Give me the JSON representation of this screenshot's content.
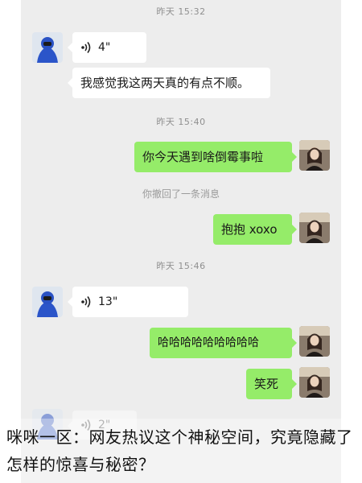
{
  "chat": {
    "messages": [
      {
        "kind": "timestamp",
        "text": "昨天 15:32"
      },
      {
        "kind": "voice",
        "side": "in",
        "duration": "4\""
      },
      {
        "kind": "text",
        "side": "in",
        "text": "我感觉我这两天真的有点不顺。"
      },
      {
        "kind": "timestamp",
        "text": "昨天 15:40"
      },
      {
        "kind": "text",
        "side": "out",
        "text": "你今天遇到啥倒霉事啦"
      },
      {
        "kind": "system",
        "text": "你撤回了一条消息"
      },
      {
        "kind": "text",
        "side": "out",
        "text": "抱抱 xoxo"
      },
      {
        "kind": "timestamp",
        "text": "昨天 15:46"
      },
      {
        "kind": "voice",
        "side": "in",
        "duration": "13\""
      },
      {
        "kind": "text",
        "side": "out",
        "text": "哈哈哈哈哈哈哈哈哈"
      },
      {
        "kind": "text",
        "side": "out",
        "text": "笑死"
      },
      {
        "kind": "voice",
        "side": "in",
        "duration": "2\""
      }
    ]
  },
  "caption": "咪咪一区：网友热议这个神秘空间，究竟隐藏了怎样的惊喜与秘密？",
  "colors": {
    "chat_bg": "#ededed",
    "out_bubble": "#95ec69",
    "in_bubble": "#ffffff"
  }
}
